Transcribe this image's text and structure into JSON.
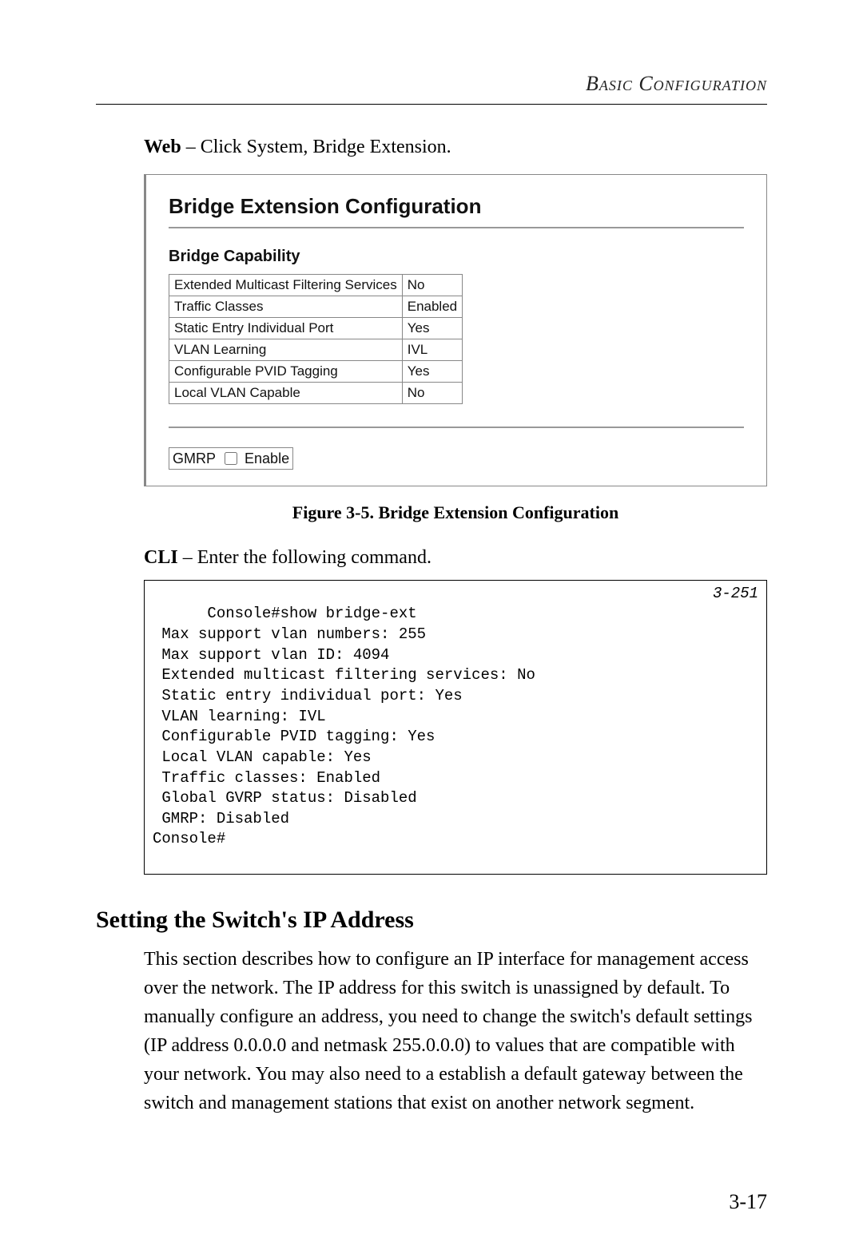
{
  "header": {
    "running_title_smallcaps": "Basic Configuration"
  },
  "web_intro": {
    "label": "Web",
    "text": " – Click System, Bridge Extension."
  },
  "screenshot": {
    "title": "Bridge Extension Configuration",
    "subtitle": "Bridge Capability",
    "table": {
      "rows": [
        {
          "label": "Extended Multicast Filtering Services",
          "value": "No"
        },
        {
          "label": "Traffic Classes",
          "value": "Enabled"
        },
        {
          "label": "Static Entry Individual Port",
          "value": "Yes"
        },
        {
          "label": "VLAN Learning",
          "value": "IVL"
        },
        {
          "label": "Configurable PVID Tagging",
          "value": "Yes"
        },
        {
          "label": "Local VLAN Capable",
          "value": "No"
        }
      ]
    },
    "gmrp": {
      "label": "GMRP",
      "checkbox_label": "Enable",
      "checked": false
    }
  },
  "figure_caption": "Figure 3-5.  Bridge Extension Configuration",
  "cli_intro": {
    "label": "CLI",
    "text": " – Enter the following command."
  },
  "console": {
    "page_ref": "3-251",
    "text": "Console#show bridge-ext\n Max support vlan numbers: 255\n Max support vlan ID: 4094\n Extended multicast filtering services: No\n Static entry individual port: Yes\n VLAN learning: IVL\n Configurable PVID tagging: Yes\n Local VLAN capable: Yes\n Traffic classes: Enabled\n Global GVRP status: Disabled\n GMRP: Disabled\nConsole#"
  },
  "section": {
    "heading": "Setting the Switch's IP Address",
    "body": "This section describes how to configure an IP interface for management access over the network. The IP address for this switch is unassigned by default. To manually configure an address, you need to change the switch's default settings (IP address 0.0.0.0 and netmask 255.0.0.0) to values that are compatible with your network. You may also need to a establish a default gateway between the switch and management stations that exist on another network segment."
  },
  "footer": {
    "page_number": "3-17"
  }
}
